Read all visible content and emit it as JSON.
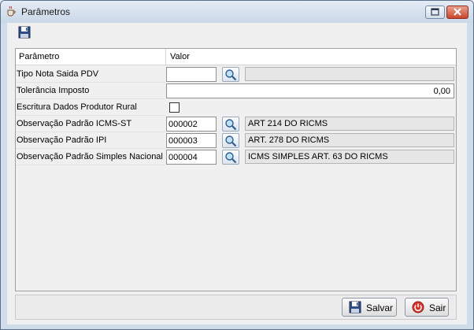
{
  "window": {
    "title": "Parâmetros"
  },
  "grid": {
    "header_param": "Parâmetro",
    "header_value": "Valor",
    "rows": [
      {
        "label": "Tipo Nota Saida PDV",
        "code": "",
        "description": ""
      },
      {
        "label": "Tolerância Imposto",
        "value": "0,00"
      },
      {
        "label": "Escritura Dados Produtor Rural",
        "checked": false
      },
      {
        "label": "Observação Padrão ICMS-ST",
        "code": "000002",
        "description": "ART 214 DO RICMS"
      },
      {
        "label": "Observação Padrão IPI",
        "code": "000003",
        "description": "ART. 278 DO RICMS"
      },
      {
        "label": "Observação Padrão Simples Nacional",
        "code": "000004",
        "description": "ICMS SIMPLES ART. 63 DO RICMS"
      }
    ]
  },
  "footer": {
    "save_label": "Salvar",
    "exit_label": "Sair"
  },
  "icons": {
    "app": "java-cup-icon",
    "save": "floppy-disk-icon",
    "lookup": "magnifier-icon",
    "exit": "power-icon",
    "restore": "restore-icon",
    "close": "close-icon"
  },
  "colors": {
    "close_button": "#c9472c",
    "exit_icon": "#d9342b",
    "desc_field": "#e6e6e6"
  }
}
